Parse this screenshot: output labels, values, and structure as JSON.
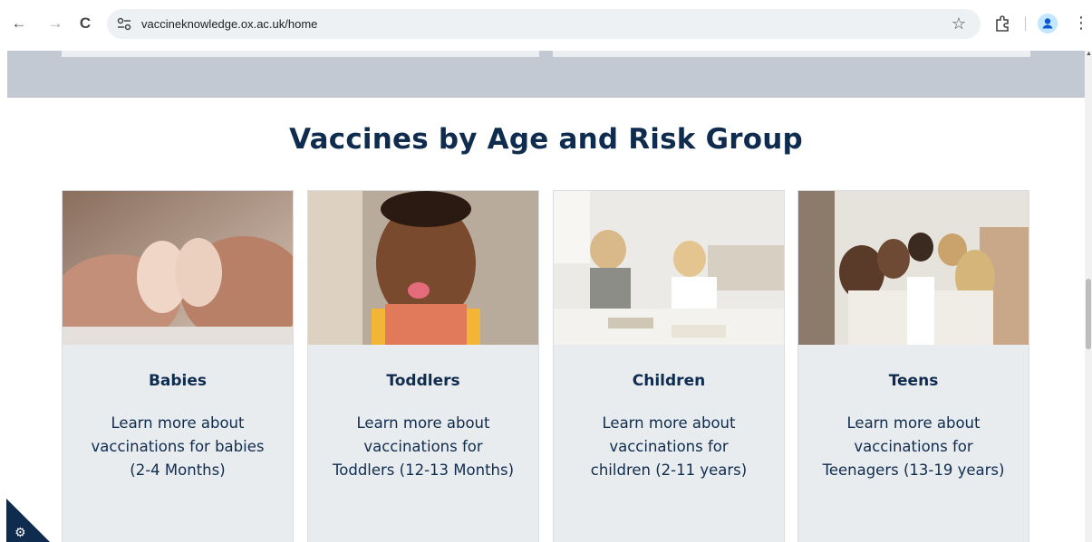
{
  "browser": {
    "url": "vaccineknowledge.ox.ac.uk/home",
    "back_icon": "←",
    "forward_icon": "→",
    "reload_icon": "C",
    "star_icon": "☆",
    "menu_icon": "⋮"
  },
  "section": {
    "heading": "Vaccines by Age and Risk Group"
  },
  "cards": [
    {
      "title": "Babies",
      "description": "Learn more about vaccinations for babies (2-4 Months)"
    },
    {
      "title": "Toddlers",
      "description": "Learn more about vaccinations for Toddlers (12-13 Months)"
    },
    {
      "title": "Children",
      "description": "Learn more about vaccinations for children (2-11 years)"
    },
    {
      "title": "Teens",
      "description": "Learn more about vaccinations for Teenagers (13-19 years)"
    }
  ],
  "accessibility_widget": {
    "icon": "gear-icon",
    "glyph": "⚙"
  },
  "colors": {
    "heading": "#0f2c4f",
    "card_bg": "#e9ecef",
    "band": "#c2c9d3"
  }
}
